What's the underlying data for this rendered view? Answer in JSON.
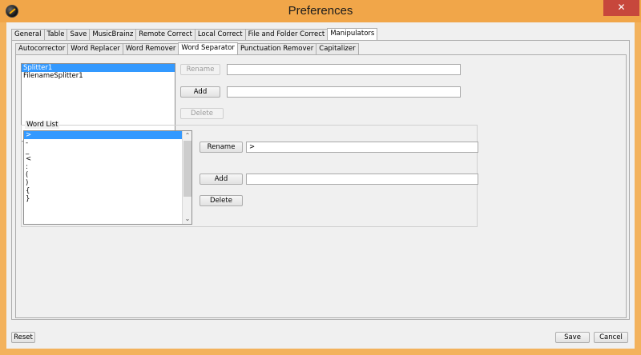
{
  "window": {
    "title": "Preferences",
    "close_glyph": "✕",
    "icon": "app-icon"
  },
  "main_tabs": [
    {
      "label": "General"
    },
    {
      "label": "Table"
    },
    {
      "label": "Save"
    },
    {
      "label": "MusicBrainz"
    },
    {
      "label": "Remote Correct"
    },
    {
      "label": "Local Correct"
    },
    {
      "label": "File and Folder Correct"
    },
    {
      "label": "Manipulators",
      "active": true
    }
  ],
  "sub_tabs": [
    {
      "label": "Autocorrector"
    },
    {
      "label": "Word Replacer"
    },
    {
      "label": "Word Remover"
    },
    {
      "label": "Word Separator",
      "active": true
    },
    {
      "label": "Punctuation Remover"
    },
    {
      "label": "Capitalizer"
    }
  ],
  "splitters": {
    "items": [
      "Splitter1",
      "FilenameSplitter1"
    ],
    "selected_index": 0,
    "rename_label": "Rename",
    "rename_value": "",
    "add_label": "Add",
    "add_value": "",
    "delete_label": "Delete"
  },
  "word_list": {
    "group_title": "Word List",
    "items": [
      ">",
      "-",
      "_",
      "<",
      ":",
      "(",
      ")",
      "{",
      "}"
    ],
    "selected_index": 0,
    "rename_label": "Rename",
    "rename_value": ">",
    "add_label": "Add",
    "add_value": "",
    "delete_label": "Delete",
    "scroll_up_glyph": "⌃",
    "scroll_down_glyph": "⌄"
  },
  "footer": {
    "reset_label": "Reset",
    "save_label": "Save",
    "cancel_label": "Cancel"
  },
  "colors": {
    "titlebar": "#f1a649",
    "close_button": "#c7473c",
    "selection": "#3399ff"
  }
}
